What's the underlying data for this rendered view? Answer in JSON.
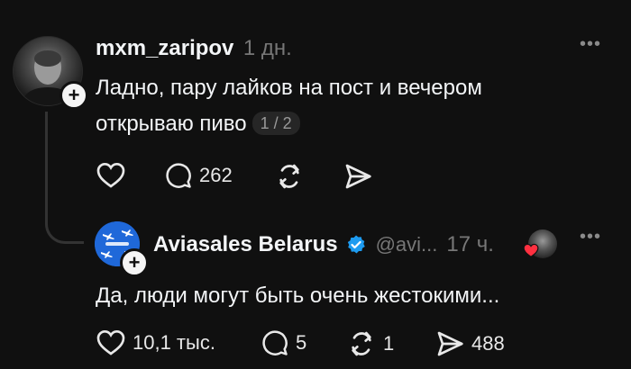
{
  "post1": {
    "username": "mxm_zaripov",
    "time": "1 дн.",
    "text": "Ладно, пару лайков на пост и вечером открываю пиво",
    "page_indicator": "1 / 2",
    "actions": {
      "comments": "262"
    }
  },
  "post2": {
    "username": "Aviasales Belarus",
    "handle": "@avi...",
    "time": "17 ч.",
    "text": "Да, люди могут быть очень жестокими...",
    "actions": {
      "likes": "10,1 тыс.",
      "comments": "5",
      "reposts": "1",
      "shares": "488"
    }
  },
  "colors": {
    "background": "#101010",
    "text": "#f3f5f7",
    "muted": "#777777",
    "verified": "#1d9bf0",
    "heart": "#ff3040"
  }
}
